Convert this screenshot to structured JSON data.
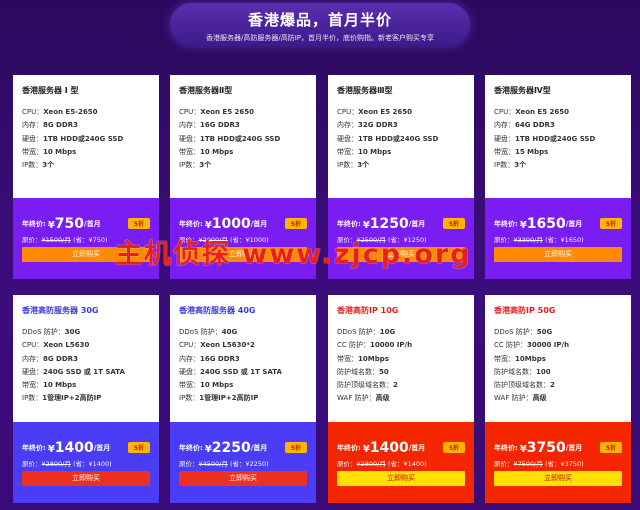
{
  "banner": {
    "title": "香港爆品，首月半价",
    "subtitle": "香港服务器/高防服务器/高防IP，首月半价，底价购指。新老客户购买专享"
  },
  "colors": {
    "purple": "#7a1df2",
    "blue": "#4a3df5",
    "red": "#f32600",
    "badge": "#ffb400"
  },
  "cards": [
    {
      "title": "香港服务器 I 型",
      "specs": [
        {
          "k": "CPU：",
          "v": "Xeon E5-2650"
        },
        {
          "k": "内存：",
          "v": "8G DDR3"
        },
        {
          "k": "硬盘：",
          "v": "1TB HDD或240G SSD"
        },
        {
          "k": "带宽：",
          "v": "10 Mbps"
        },
        {
          "k": "IP数：",
          "v": "3个"
        }
      ],
      "price_label": "年终价:",
      "currency": "¥",
      "price": "750",
      "unit": "/首月",
      "badge": "5折",
      "orig_label": "原价：",
      "orig": "¥1500/月",
      "saving": "(省：¥750)",
      "button": "立即购买"
    },
    {
      "title": "香港服务器Ⅱ型",
      "specs": [
        {
          "k": "CPU：",
          "v": "Xeon E5 2650"
        },
        {
          "k": "内存：",
          "v": "16G DDR3"
        },
        {
          "k": "硬盘：",
          "v": "1TB HDD或240G SSD"
        },
        {
          "k": "带宽：",
          "v": "10 Mbps"
        },
        {
          "k": "IP数：",
          "v": "3个"
        }
      ],
      "price_label": "年终价:",
      "currency": "¥",
      "price": "1000",
      "unit": "/首月",
      "badge": "5折",
      "orig_label": "原价：",
      "orig": "¥2000/月",
      "saving": "(省：¥1000)",
      "button": "立即购买"
    },
    {
      "title": "香港服务器Ⅲ型",
      "specs": [
        {
          "k": "CPU：",
          "v": "Xeon E5 2650"
        },
        {
          "k": "内存：",
          "v": "32G DDR3"
        },
        {
          "k": "硬盘：",
          "v": "1TB HDD或240G SSD"
        },
        {
          "k": "带宽：",
          "v": "10 Mbps"
        },
        {
          "k": "IP数：",
          "v": "3个"
        }
      ],
      "price_label": "年终价:",
      "currency": "¥",
      "price": "1250",
      "unit": "/首月",
      "badge": "5折",
      "orig_label": "原价：",
      "orig": "¥2500/月",
      "saving": "(省：¥1250)",
      "button": "立即购买"
    },
    {
      "title": "香港服务器Ⅳ型",
      "specs": [
        {
          "k": "CPU：",
          "v": "Xeon E5 2650"
        },
        {
          "k": "内存：",
          "v": "64G DDR3"
        },
        {
          "k": "硬盘：",
          "v": "1TB HDD或240G SSD"
        },
        {
          "k": "带宽：",
          "v": "15 Mbps"
        },
        {
          "k": "IP数：",
          "v": "3个"
        }
      ],
      "price_label": "年终价:",
      "currency": "¥",
      "price": "1650",
      "unit": "/首月",
      "badge": "5折",
      "orig_label": "原价：",
      "orig": "¥3300/月",
      "saving": "(省：¥1650)",
      "button": "立即购买"
    },
    {
      "title": "香港高防服务器 30G",
      "specs": [
        {
          "k": "DDoS 防护：",
          "v": "30G"
        },
        {
          "k": "CPU：",
          "v": "Xeon L5630"
        },
        {
          "k": "内存：",
          "v": "8G DDR3"
        },
        {
          "k": "硬盘：",
          "v": "240G SSD 或 1T SATA"
        },
        {
          "k": "带宽：",
          "v": "10 Mbps"
        },
        {
          "k": "IP数：",
          "v": "1管理IP+2高防IP"
        }
      ],
      "price_label": "年终价:",
      "currency": "¥",
      "price": "1400",
      "unit": "/首月",
      "badge": "5折",
      "orig_label": "原价：",
      "orig": "¥2800/月",
      "saving": "(省：¥1400)",
      "button": "立即购买"
    },
    {
      "title": "香港高防服务器 40G",
      "specs": [
        {
          "k": "DDoS 防护：",
          "v": "40G"
        },
        {
          "k": "CPU：",
          "v": "Xeon L5630*2"
        },
        {
          "k": "内存：",
          "v": "16G DDR3"
        },
        {
          "k": "硬盘：",
          "v": "240G SSD 或 1T SATA"
        },
        {
          "k": "带宽：",
          "v": "10 Mbps"
        },
        {
          "k": "IP数：",
          "v": "1管理IP+2高防IP"
        }
      ],
      "price_label": "年终价:",
      "currency": "¥",
      "price": "2250",
      "unit": "/首月",
      "badge": "5折",
      "orig_label": "原价：",
      "orig": "¥4500/月",
      "saving": "(省：¥2250)",
      "button": "立即购买"
    },
    {
      "title": "香港高防IP 10G",
      "specs": [
        {
          "k": "DDoS 防护：",
          "v": "10G"
        },
        {
          "k": "CC 防护：",
          "v": "10000 IP/h"
        },
        {
          "k": "带宽：",
          "v": "10Mbps"
        },
        {
          "k": "防护域名数：",
          "v": "50"
        },
        {
          "k": "防护顶级域名数：",
          "v": "2"
        },
        {
          "k": "WAF 防护：",
          "v": "高级"
        }
      ],
      "price_label": "年终价:",
      "currency": "¥",
      "price": "1400",
      "unit": "/首月",
      "badge": "5折",
      "orig_label": "原价：",
      "orig": "¥2800/月",
      "saving": "(省：¥1400)",
      "button": "立即购买"
    },
    {
      "title": "香港高防IP 50G",
      "specs": [
        {
          "k": "DDoS 防护：",
          "v": "50G"
        },
        {
          "k": "CC 防护：",
          "v": "30000 IP/h"
        },
        {
          "k": "带宽：",
          "v": "10Mbps"
        },
        {
          "k": "防护域名数：",
          "v": "100"
        },
        {
          "k": "防护顶级域名数：",
          "v": "2"
        },
        {
          "k": "WAF 防护：",
          "v": "高级"
        }
      ],
      "price_label": "年终价:",
      "currency": "¥",
      "price": "3750",
      "unit": "/首月",
      "badge": "5折",
      "orig_label": "原价：",
      "orig": "¥7500/月",
      "saving": "(省：¥3750)",
      "button": "立即购买"
    }
  ],
  "watermark": "主机侦探 www.zjcp.org"
}
